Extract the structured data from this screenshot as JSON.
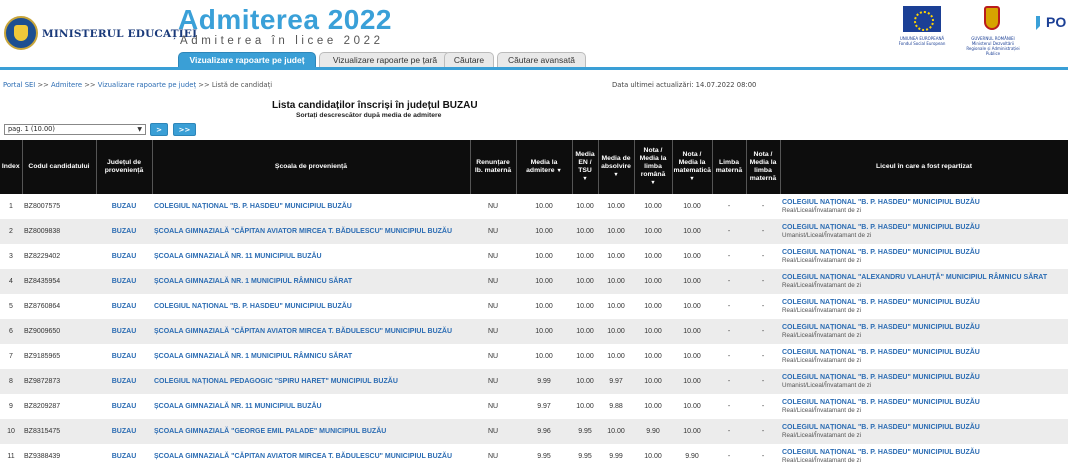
{
  "header": {
    "ministry": "MINISTERUL EDUCAȚIEI",
    "app_title": "Admiterea 2022",
    "app_subtitle": "Admiterea în licee 2022",
    "eu_caption": "UNIUNEA EUROPEANĂ Fondul Social European",
    "gov_caption": "GUVERNUL ROMÂNIEI Ministerul Dezvoltării Regionale și Administrației Publice",
    "po_logo": "PO"
  },
  "tabs": [
    {
      "label": "Vizualizare rapoarte pe județ",
      "active": true
    },
    {
      "label": "Vizualizare rapoarte pe țară",
      "active": false
    },
    {
      "label": "Căutare",
      "active": false
    },
    {
      "label": "Căutare avansată",
      "active": false
    }
  ],
  "breadcrumb": {
    "items": [
      "Portal SEI",
      "Admitere",
      "Vizualizare rapoarte pe județ"
    ],
    "separator": " >> ",
    "current": "Listă de candidați"
  },
  "last_update": "Data ultimei actualizări: 14.07.2022 08:00",
  "list_title": "Lista candidaților înscriși în județul BUZAU",
  "list_subtitle": "Sortați descrescător după media de admitere",
  "pager": {
    "selected": "pag. 1 (10.00)",
    "next_label": ">",
    "last_label": ">>"
  },
  "table": {
    "headers": {
      "index": "Index",
      "code": "Codul candidatului",
      "county": "Județul de proveniență",
      "school": "Școala de proveniență",
      "renunt": "Renunțare lb. maternă",
      "media_adm": "Media la admitere",
      "media_en": "Media EN / TSU",
      "media_abs": "Media de absolvire",
      "nota_ro": "Nota / Media la limba română",
      "nota_mat": "Nota / Media la matematică",
      "limba_mat": "Limba maternă",
      "nota_lm": "Nota / Media la limba maternă",
      "liceu": "Liceul în care a fost repartizat"
    },
    "rows": [
      {
        "index": "1",
        "code": "BZ8007575",
        "county": "BUZAU",
        "school": "COLEGIUL NAȚIONAL \"B. P. HASDEU\" MUNICIPIUL BUZĂU",
        "renunt": "NU",
        "media_adm": "10.00",
        "media_en": "10.00",
        "media_abs": "10.00",
        "nota_ro": "10.00",
        "nota_mat": "10.00",
        "limba_mat": "-",
        "nota_lm": "-",
        "liceu": "COLEGIUL NAȚIONAL \"B. P. HASDEU\" MUNICIPIUL BUZĂU",
        "spec": "Real/Liceal/Învatamant de zi"
      },
      {
        "index": "2",
        "code": "BZ8009838",
        "county": "BUZAU",
        "school": "ȘCOALA GIMNAZIALĂ \"CĂPITAN AVIATOR MIRCEA T. BĂDULESCU\" MUNICIPIUL BUZĂU",
        "renunt": "NU",
        "media_adm": "10.00",
        "media_en": "10.00",
        "media_abs": "10.00",
        "nota_ro": "10.00",
        "nota_mat": "10.00",
        "limba_mat": "-",
        "nota_lm": "-",
        "liceu": "COLEGIUL NAȚIONAL \"B. P. HASDEU\" MUNICIPIUL BUZĂU",
        "spec": "Umanist/Liceal/Învatamant de zi"
      },
      {
        "index": "3",
        "code": "BZ8229402",
        "county": "BUZAU",
        "school": "ȘCOALA GIMNAZIALĂ NR. 11 MUNICIPIUL BUZĂU",
        "renunt": "NU",
        "media_adm": "10.00",
        "media_en": "10.00",
        "media_abs": "10.00",
        "nota_ro": "10.00",
        "nota_mat": "10.00",
        "limba_mat": "-",
        "nota_lm": "-",
        "liceu": "COLEGIUL NAȚIONAL \"B. P. HASDEU\" MUNICIPIUL BUZĂU",
        "spec": "Real/Liceal/Învatamant de zi"
      },
      {
        "index": "4",
        "code": "BZ8435954",
        "county": "BUZAU",
        "school": "ȘCOALA GIMNAZIALĂ NR. 1 MUNICIPIUL RÂMNICU SĂRAT",
        "renunt": "NU",
        "media_adm": "10.00",
        "media_en": "10.00",
        "media_abs": "10.00",
        "nota_ro": "10.00",
        "nota_mat": "10.00",
        "limba_mat": "-",
        "nota_lm": "-",
        "liceu": "COLEGIUL NAȚIONAL \"ALEXANDRU VLAHUȚĂ\" MUNICIPIUL RÂMNICU SĂRAT",
        "spec": "Real/Liceal/Învatamant de zi"
      },
      {
        "index": "5",
        "code": "BZ8760864",
        "county": "BUZAU",
        "school": "COLEGIUL NAȚIONAL \"B. P. HASDEU\" MUNICIPIUL BUZĂU",
        "renunt": "NU",
        "media_adm": "10.00",
        "media_en": "10.00",
        "media_abs": "10.00",
        "nota_ro": "10.00",
        "nota_mat": "10.00",
        "limba_mat": "-",
        "nota_lm": "-",
        "liceu": "COLEGIUL NAȚIONAL \"B. P. HASDEU\" MUNICIPIUL BUZĂU",
        "spec": "Real/Liceal/Învatamant de zi"
      },
      {
        "index": "6",
        "code": "BZ9009650",
        "county": "BUZAU",
        "school": "ȘCOALA GIMNAZIALĂ \"CĂPITAN AVIATOR MIRCEA T. BĂDULESCU\" MUNICIPIUL BUZĂU",
        "renunt": "NU",
        "media_adm": "10.00",
        "media_en": "10.00",
        "media_abs": "10.00",
        "nota_ro": "10.00",
        "nota_mat": "10.00",
        "limba_mat": "-",
        "nota_lm": "-",
        "liceu": "COLEGIUL NAȚIONAL \"B. P. HASDEU\" MUNICIPIUL BUZĂU",
        "spec": "Real/Liceal/Învatamant de zi"
      },
      {
        "index": "7",
        "code": "BZ9185965",
        "county": "BUZAU",
        "school": "ȘCOALA GIMNAZIALĂ NR. 1 MUNICIPIUL RÂMNICU SĂRAT",
        "renunt": "NU",
        "media_adm": "10.00",
        "media_en": "10.00",
        "media_abs": "10.00",
        "nota_ro": "10.00",
        "nota_mat": "10.00",
        "limba_mat": "-",
        "nota_lm": "-",
        "liceu": "COLEGIUL NAȚIONAL \"B. P. HASDEU\" MUNICIPIUL BUZĂU",
        "spec": "Real/Liceal/Învatamant de zi"
      },
      {
        "index": "8",
        "code": "BZ9872873",
        "county": "BUZAU",
        "school": "COLEGIUL NAȚIONAL PEDAGOGIC \"SPIRU HARET\" MUNICIPIUL BUZĂU",
        "renunt": "NU",
        "media_adm": "9.99",
        "media_en": "10.00",
        "media_abs": "9.97",
        "nota_ro": "10.00",
        "nota_mat": "10.00",
        "limba_mat": "-",
        "nota_lm": "-",
        "liceu": "COLEGIUL NAȚIONAL \"B. P. HASDEU\" MUNICIPIUL BUZĂU",
        "spec": "Umanist/Liceal/Învatamant de zi"
      },
      {
        "index": "9",
        "code": "BZ8209287",
        "county": "BUZAU",
        "school": "ȘCOALA GIMNAZIALĂ NR. 11 MUNICIPIUL BUZĂU",
        "renunt": "NU",
        "media_adm": "9.97",
        "media_en": "10.00",
        "media_abs": "9.88",
        "nota_ro": "10.00",
        "nota_mat": "10.00",
        "limba_mat": "-",
        "nota_lm": "-",
        "liceu": "COLEGIUL NAȚIONAL \"B. P. HASDEU\" MUNICIPIUL BUZĂU",
        "spec": "Real/Liceal/Învatamant de zi"
      },
      {
        "index": "10",
        "code": "BZ8315475",
        "county": "BUZAU",
        "school": "ȘCOALA GIMNAZIALĂ \"GEORGE EMIL PALADE\" MUNICIPIUL BUZĂU",
        "renunt": "NU",
        "media_adm": "9.96",
        "media_en": "9.95",
        "media_abs": "10.00",
        "nota_ro": "9.90",
        "nota_mat": "10.00",
        "limba_mat": "-",
        "nota_lm": "-",
        "liceu": "COLEGIUL NAȚIONAL \"B. P. HASDEU\" MUNICIPIUL BUZĂU",
        "spec": "Real/Liceal/Învatamant de zi"
      },
      {
        "index": "11",
        "code": "BZ9388439",
        "county": "BUZAU",
        "school": "ȘCOALA GIMNAZIALĂ \"CĂPITAN AVIATOR MIRCEA T. BĂDULESCU\" MUNICIPIUL BUZĂU",
        "renunt": "NU",
        "media_adm": "9.95",
        "media_en": "9.95",
        "media_abs": "9.99",
        "nota_ro": "10.00",
        "nota_mat": "9.90",
        "limba_mat": "-",
        "nota_lm": "-",
        "liceu": "COLEGIUL NAȚIONAL \"B. P. HASDEU\" MUNICIPIUL BUZĂU",
        "spec": "Real/Liceal/Învatamant de zi"
      }
    ]
  }
}
